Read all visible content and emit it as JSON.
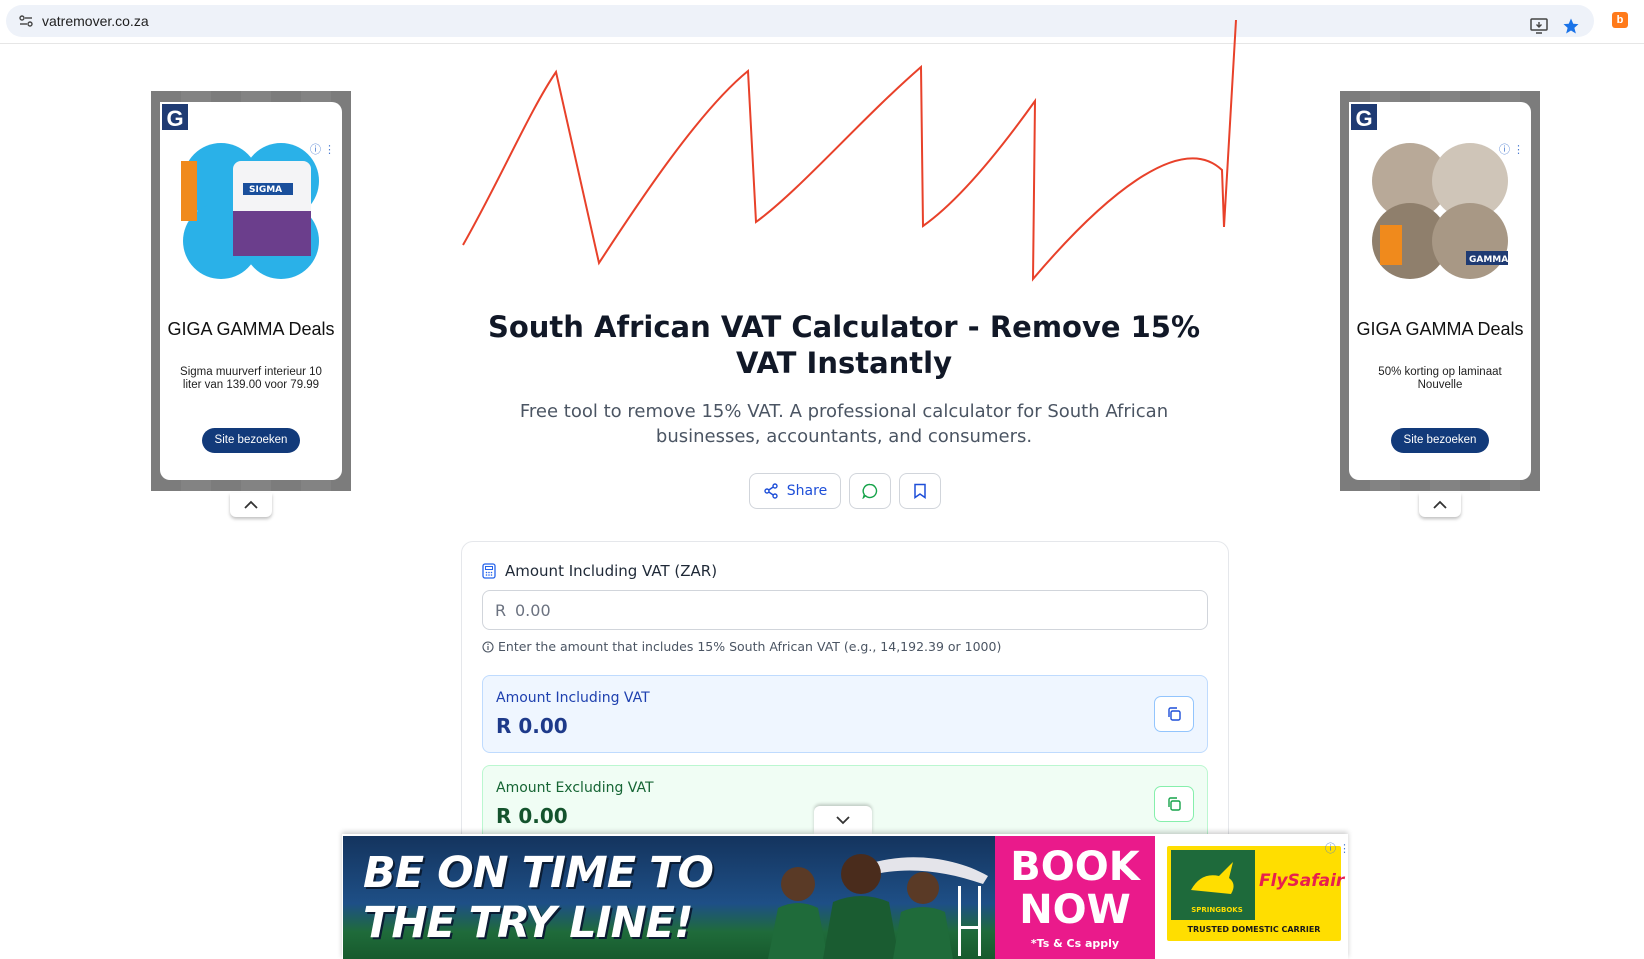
{
  "browser": {
    "url": "vatremover.co.za"
  },
  "ads": {
    "left": {
      "title": "GIGA GAMMA Deals",
      "description": "Sigma muurverf interieur 10 liter van 139.00 voor 79.99",
      "button": "Site bezoeken",
      "brand_letter": "G",
      "product_brand": "SIGMA"
    },
    "right": {
      "title": "GIGA GAMMA Deals",
      "description": "50% korting op laminaat Nouvelle",
      "button": "Site bezoeken",
      "brand_letter": "G",
      "product_brand": "GAMMA"
    },
    "bottom": {
      "headline": "BE ON TIME TO THE TRY LINE!",
      "cta": "BOOK NOW",
      "terms": "*Ts & Cs apply",
      "airline": "FlySafair",
      "team": "SPRINGBOKS",
      "tagline": "TRUSTED DOMESTIC CARRIER"
    }
  },
  "hero": {
    "title": "South African VAT Calculator - Remove 15% VAT Instantly",
    "subtitle": "Free tool to remove 15% VAT. A professional calculator for South African businesses, accountants, and consumers."
  },
  "actions": {
    "share_label": "Share"
  },
  "calculator": {
    "amount_label": "Amount Including VAT (ZAR)",
    "currency_prefix": "R",
    "input_placeholder": "0.00",
    "hint": "Enter the amount that includes 15% South African VAT (e.g., 14,192.39 or 1000)",
    "results": [
      {
        "label": "Amount Including VAT",
        "value": "R 0.00"
      },
      {
        "label": "Amount Excluding VAT",
        "value": "R 0.00"
      }
    ]
  },
  "colors": {
    "accent_blue": "#1d4ed8",
    "scribble_red": "#e8412a",
    "ad_navy": "#123a7a",
    "pink": "#ea1a8b"
  },
  "icons": [
    "site-settings-icon",
    "install-app-icon",
    "bookmark-star-icon",
    "extension-icon",
    "share-icon",
    "whatsapp-icon",
    "bookmark-icon",
    "calculator-icon",
    "info-icon",
    "copy-icon",
    "chevron-up-icon",
    "chevron-down-icon"
  ]
}
